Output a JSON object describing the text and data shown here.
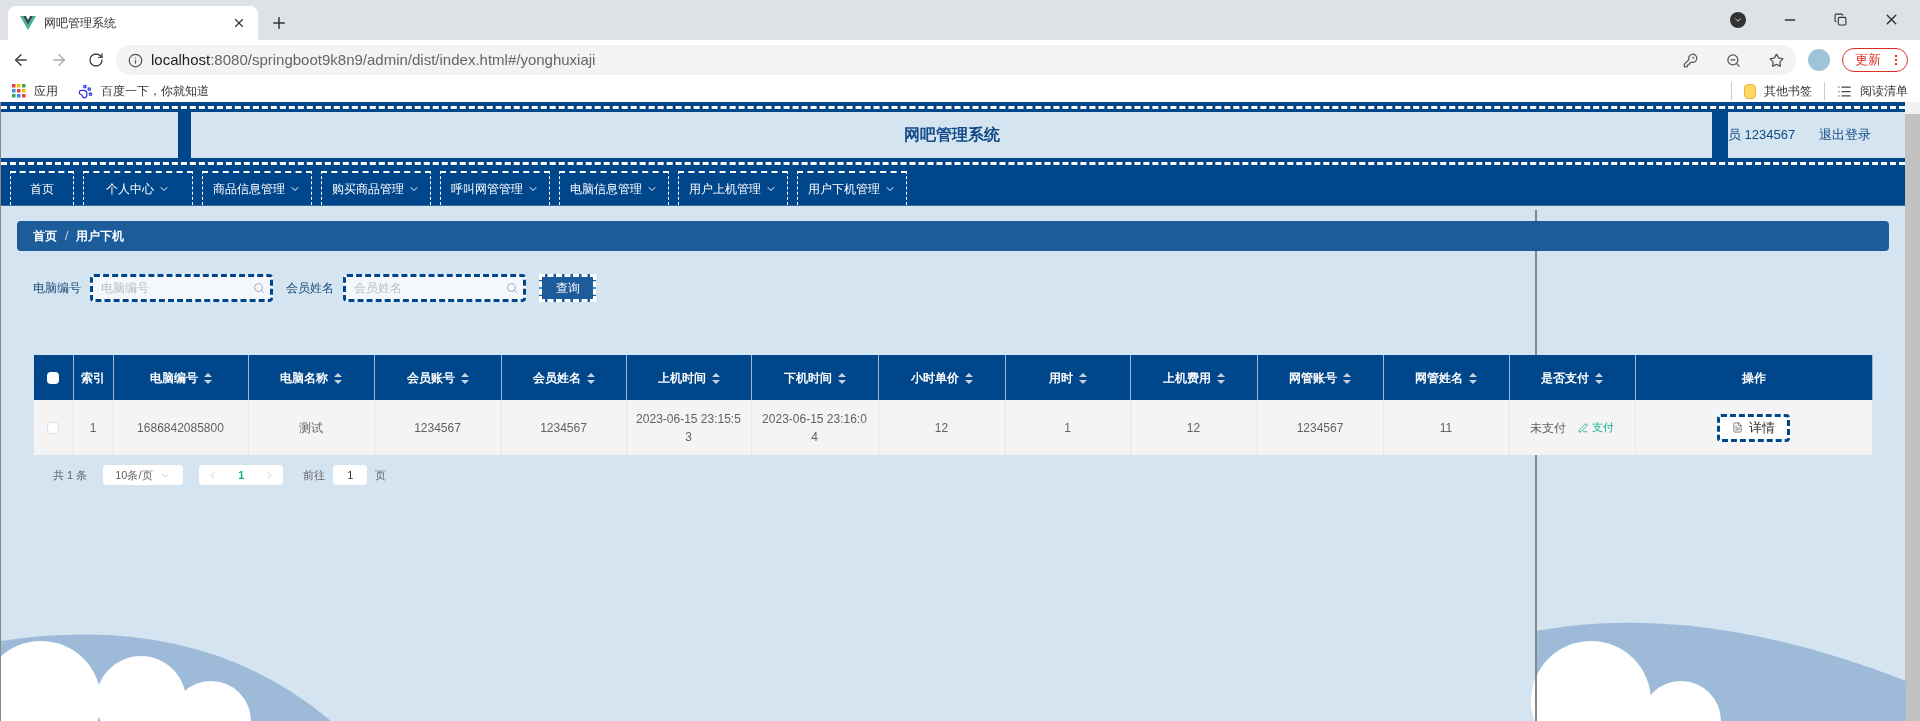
{
  "browser": {
    "tab_title": "网吧管理系统",
    "url_host": "localhost",
    "url_rest": ":8080/springboot9k8n9/admin/dist/index.html#/yonghuxiaji",
    "update_button": "更新",
    "bookmarks": [
      {
        "label": "应用",
        "kind": "apps"
      },
      {
        "label": "百度一下，你就知道",
        "kind": "paw"
      }
    ],
    "bookmarks_right": [
      {
        "label": "其他书签",
        "kind": "folder"
      },
      {
        "label": "阅读清单",
        "kind": "list"
      }
    ]
  },
  "header": {
    "title": "网吧管理系统",
    "user": "员 1234567",
    "logout": "退出登录"
  },
  "nav": [
    {
      "label": "首页",
      "dropdown": false
    },
    {
      "label": "个人中心",
      "dropdown": true
    },
    {
      "label": "商品信息管理",
      "dropdown": true
    },
    {
      "label": "购买商品管理",
      "dropdown": true
    },
    {
      "label": "呼叫网管管理",
      "dropdown": true
    },
    {
      "label": "电脑信息管理",
      "dropdown": true
    },
    {
      "label": "用户上机管理",
      "dropdown": true
    },
    {
      "label": "用户下机管理",
      "dropdown": true
    }
  ],
  "breadcrumb": [
    "首页",
    "用户下机"
  ],
  "breadcrumb_separator": "/",
  "search": {
    "fields": [
      {
        "label": "电脑编号",
        "placeholder": "电脑编号"
      },
      {
        "label": "会员姓名",
        "placeholder": "会员姓名"
      }
    ],
    "button": "查询"
  },
  "table": {
    "select_all_checked": false,
    "columns": [
      {
        "label": "索引",
        "sortable": false
      },
      {
        "label": "电脑编号",
        "sortable": true
      },
      {
        "label": "电脑名称",
        "sortable": true
      },
      {
        "label": "会员账号",
        "sortable": true
      },
      {
        "label": "会员姓名",
        "sortable": true
      },
      {
        "label": "上机时间",
        "sortable": true
      },
      {
        "label": "下机时间",
        "sortable": true
      },
      {
        "label": "小时单价",
        "sortable": true
      },
      {
        "label": "用时",
        "sortable": true
      },
      {
        "label": "上机费用",
        "sortable": true
      },
      {
        "label": "网管账号",
        "sortable": true
      },
      {
        "label": "网管姓名",
        "sortable": true
      },
      {
        "label": "是否支付",
        "sortable": true
      },
      {
        "label": "操作",
        "sortable": false
      }
    ],
    "rows": [
      {
        "checked": false,
        "cells": [
          "1",
          "1686842085800",
          "测试",
          "1234567",
          "1234567",
          "2023-06-15 23:15:53",
          "2023-06-15 23:16:04",
          "12",
          "1",
          "12",
          "1234567",
          "11"
        ],
        "paid_status": "未支付",
        "pay_link": "支付",
        "detail_button": "详情"
      }
    ]
  },
  "pagination": {
    "total": "共 1 条",
    "page_size": "10条/页",
    "pages": [
      {
        "label": "1",
        "selected": true
      }
    ],
    "goto_label": "前往",
    "goto_value": "1",
    "page_unit": "页"
  }
}
